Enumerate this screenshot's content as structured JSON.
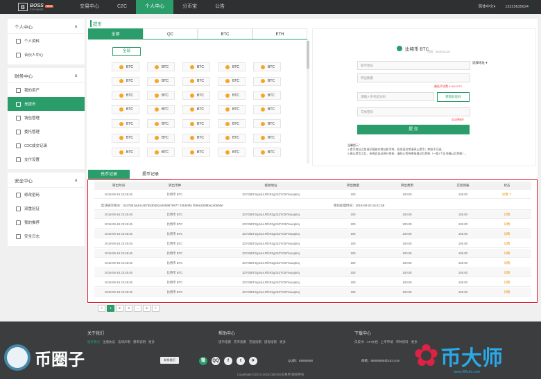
{
  "header": {
    "logo_letter": "B",
    "logo_name": "BOSS",
    "logo_sub": "EXCHANGE",
    "logo_tag": "NEW",
    "nav": [
      "交易中心",
      "C2C",
      "个人中心",
      "分币宝",
      "公告"
    ],
    "active_nav": 2,
    "lang": "简体中文▾",
    "phone": "13225635624",
    "lang_icon": "chevron-down-icon"
  },
  "sidebar": {
    "groups": [
      {
        "title": "个人中心",
        "items": [
          "个人资料",
          "合伙人中心"
        ]
      },
      {
        "title": "财务中心",
        "items": [
          "我的资产",
          "充提币",
          "钱包管理",
          "委托管理",
          "C2C成交记录",
          "支付设置"
        ]
      },
      {
        "title": "安全中心",
        "items": [
          "修改密码",
          "双重验证",
          "我的推荐",
          "安全日志"
        ]
      }
    ],
    "active": "充提币"
  },
  "page_title": "提币",
  "coin_tabs": [
    "全部",
    "QC",
    "BTC",
    "ETH"
  ],
  "all_button": "全部",
  "coin_label": "BTC",
  "withdraw": {
    "title": "比特币 BTC",
    "sub": "可用：4525.52220",
    "address_ph": "提币地址",
    "select_addr": "选择地址 ▾",
    "amount_ph": "转出数量",
    "fee_note": "最低手续费 0.001 BTC",
    "code_ph": "请输入手机验证码",
    "get_code": "获取验证码",
    "pwd_ph": "交易密码",
    "forgot": "忘记密码？",
    "submit": "提 交",
    "tips_title": "温馨提示：",
    "tips": "1.提币地址之前请仔细核对地址和币种，如发现异常请停止提币；转账不可逆。",
    "tips2": "2.确认提币之后，系统会自动进行审核，请耐心等待审核通过后到账（一般1个区块确认后到账）。"
  },
  "record_tabs": [
    "充币记录",
    "提币记录"
  ],
  "table": {
    "headers": [
      "转出时间",
      "转出币种",
      "接收地址",
      "转出数量",
      "转出费用",
      "实际到账",
      "状态"
    ],
    "rows": [
      {
        "time": "2018-09-18 23:45:45",
        "coin": "比特币 BTC",
        "addr": "1DY3bEF2g44ur.RfcR2gJSZYC8Y6uuqtmq",
        "amount": "100",
        "fee": "100.00",
        "actual": "100.00",
        "status": "详情 ∨"
      },
      {
        "time": "2018-09-18 23:45:45",
        "coin": "比特币 BTC",
        "addr": "1DY3bEF2g44ur.RfcR2gJSZYC8Y6uuqtmq",
        "amount": "100",
        "fee": "100.00",
        "actual": "100.00",
        "status": "详情"
      },
      {
        "time": "2018-09-18 23:45:45",
        "coin": "比特币 BTC",
        "addr": "1DY3bEF2g44ur.RfcR2gJSZYC8Y6uuqtmq",
        "amount": "100",
        "fee": "100.00",
        "actual": "100.00",
        "status": "详情"
      },
      {
        "time": "2018-09-18 23:45:45",
        "coin": "比特币 BTC",
        "addr": "1DY3bEF2g44ur.RfcR2gJSZYC8Y6uuqtmq",
        "amount": "100",
        "fee": "100.00",
        "actual": "100.00",
        "status": "详情"
      },
      {
        "time": "2018-09-18 23:45:45",
        "coin": "比特币 BTC",
        "addr": "1DY3bEF2g44ur.RfcR2gJSZYC8Y6uuqtmq",
        "amount": "100",
        "fee": "100.00",
        "actual": "100.00",
        "status": "详情"
      },
      {
        "time": "2018-09-18 23:45:45",
        "coin": "比特币 BTC",
        "addr": "1DY3bEF2g44ur.RfcR2gJSZYC8Y6uuqtmq",
        "amount": "100",
        "fee": "100.00",
        "actual": "100.00",
        "status": "详情"
      },
      {
        "time": "2018-09-18 23:45:45",
        "coin": "比特币 BTC",
        "addr": "1DY3bEF2g44ur.RfcR2gJSZYC8Y6uuqtmq",
        "amount": "100",
        "fee": "100.00",
        "actual": "100.00",
        "status": "详情"
      },
      {
        "time": "2018-09-18 23:45:45",
        "coin": "比特币 BTC",
        "addr": "1DY3bEF2g44ur.RfcR2gJSZYC8Y6uuqtmq",
        "amount": "100",
        "fee": "100.00",
        "actual": "100.00",
        "status": "详情"
      },
      {
        "time": "2018-09-18 23:45:45",
        "coin": "比特币 BTC",
        "addr": "1DY3bEF2g44ur.RfcR2gJSZYC8Y6uuqtmq",
        "amount": "100",
        "fee": "100.00",
        "actual": "100.00",
        "status": "详情"
      },
      {
        "time": "2018-09-18 23:45:45",
        "coin": "比特币 BTC",
        "addr": "1DY3bEF2g44ur.RfcR2gJSZYC8Y6uuqtmq",
        "amount": "100",
        "fee": "100.00",
        "actual": "100.00",
        "status": "详情"
      }
    ],
    "hash": "区块链交易ID：0x37891w44c457d53b581a4059879877 4f4d49fa f289a3308ba1d06b5e",
    "process_time": "钱包处理时间：2018-08-20 16:41:59"
  },
  "pager": [
    "<",
    "1",
    "2",
    "3",
    "...",
    "5",
    ">"
  ],
  "active_page": "1",
  "footer": {
    "about": "关于我们",
    "about_links": [
      "联系我们",
      "注册协议",
      "法律声明",
      "费率说明",
      "更多"
    ],
    "help": "帮助中心",
    "help_links": [
      "提币指南",
      "充币指南",
      "充值指南",
      "提现指南",
      "更多"
    ],
    "download": "下载中心",
    "download_links": [
      "白皮书",
      "API文档",
      "上币申请",
      "币种资料",
      "更多"
    ],
    "join": "联系我们",
    "social": [
      "微",
      "QQ",
      "f",
      "t",
      "✈"
    ],
    "qq": "QQ群：88888888",
    "email": "邮箱：88888888@163.com",
    "copyright": "CopyRight ©2013-2018 DBOSS交易所 版权所有",
    "wm_left": "币圈子",
    "wm_right": "币大师",
    "wm_url": "www.99hufu.com"
  }
}
